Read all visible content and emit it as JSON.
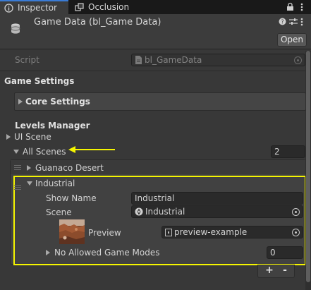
{
  "tabs": {
    "inspector": "Inspector",
    "occlusion": "Occlusion"
  },
  "header": {
    "title": "Game Data (bl_Game Data)",
    "open_button": "Open"
  },
  "script_row": {
    "label": "Script",
    "value": "bl_GameData"
  },
  "sections": {
    "game_settings": "Game Settings",
    "core_settings": "Core Settings",
    "levels_manager": "Levels Manager",
    "ui_scene": "UI Scene",
    "all_scenes": "All Scenes",
    "all_scenes_count": "2"
  },
  "scenes": [
    {
      "name": "Guanaco Desert"
    },
    {
      "name": "Industrial",
      "show_name_label": "Show Name",
      "show_name_value": "Industrial",
      "scene_label": "Scene",
      "scene_value": "Industrial",
      "preview_label": "Preview",
      "preview_value": "preview-example",
      "no_allowed_label": "No Allowed Game Modes",
      "no_allowed_value": "0"
    }
  ],
  "list_buttons": {
    "add": "+",
    "remove": "-"
  },
  "colors": {
    "accent": "#3a7bd5",
    "highlight_box": "#f5f500",
    "arrow": "#f5f500"
  }
}
